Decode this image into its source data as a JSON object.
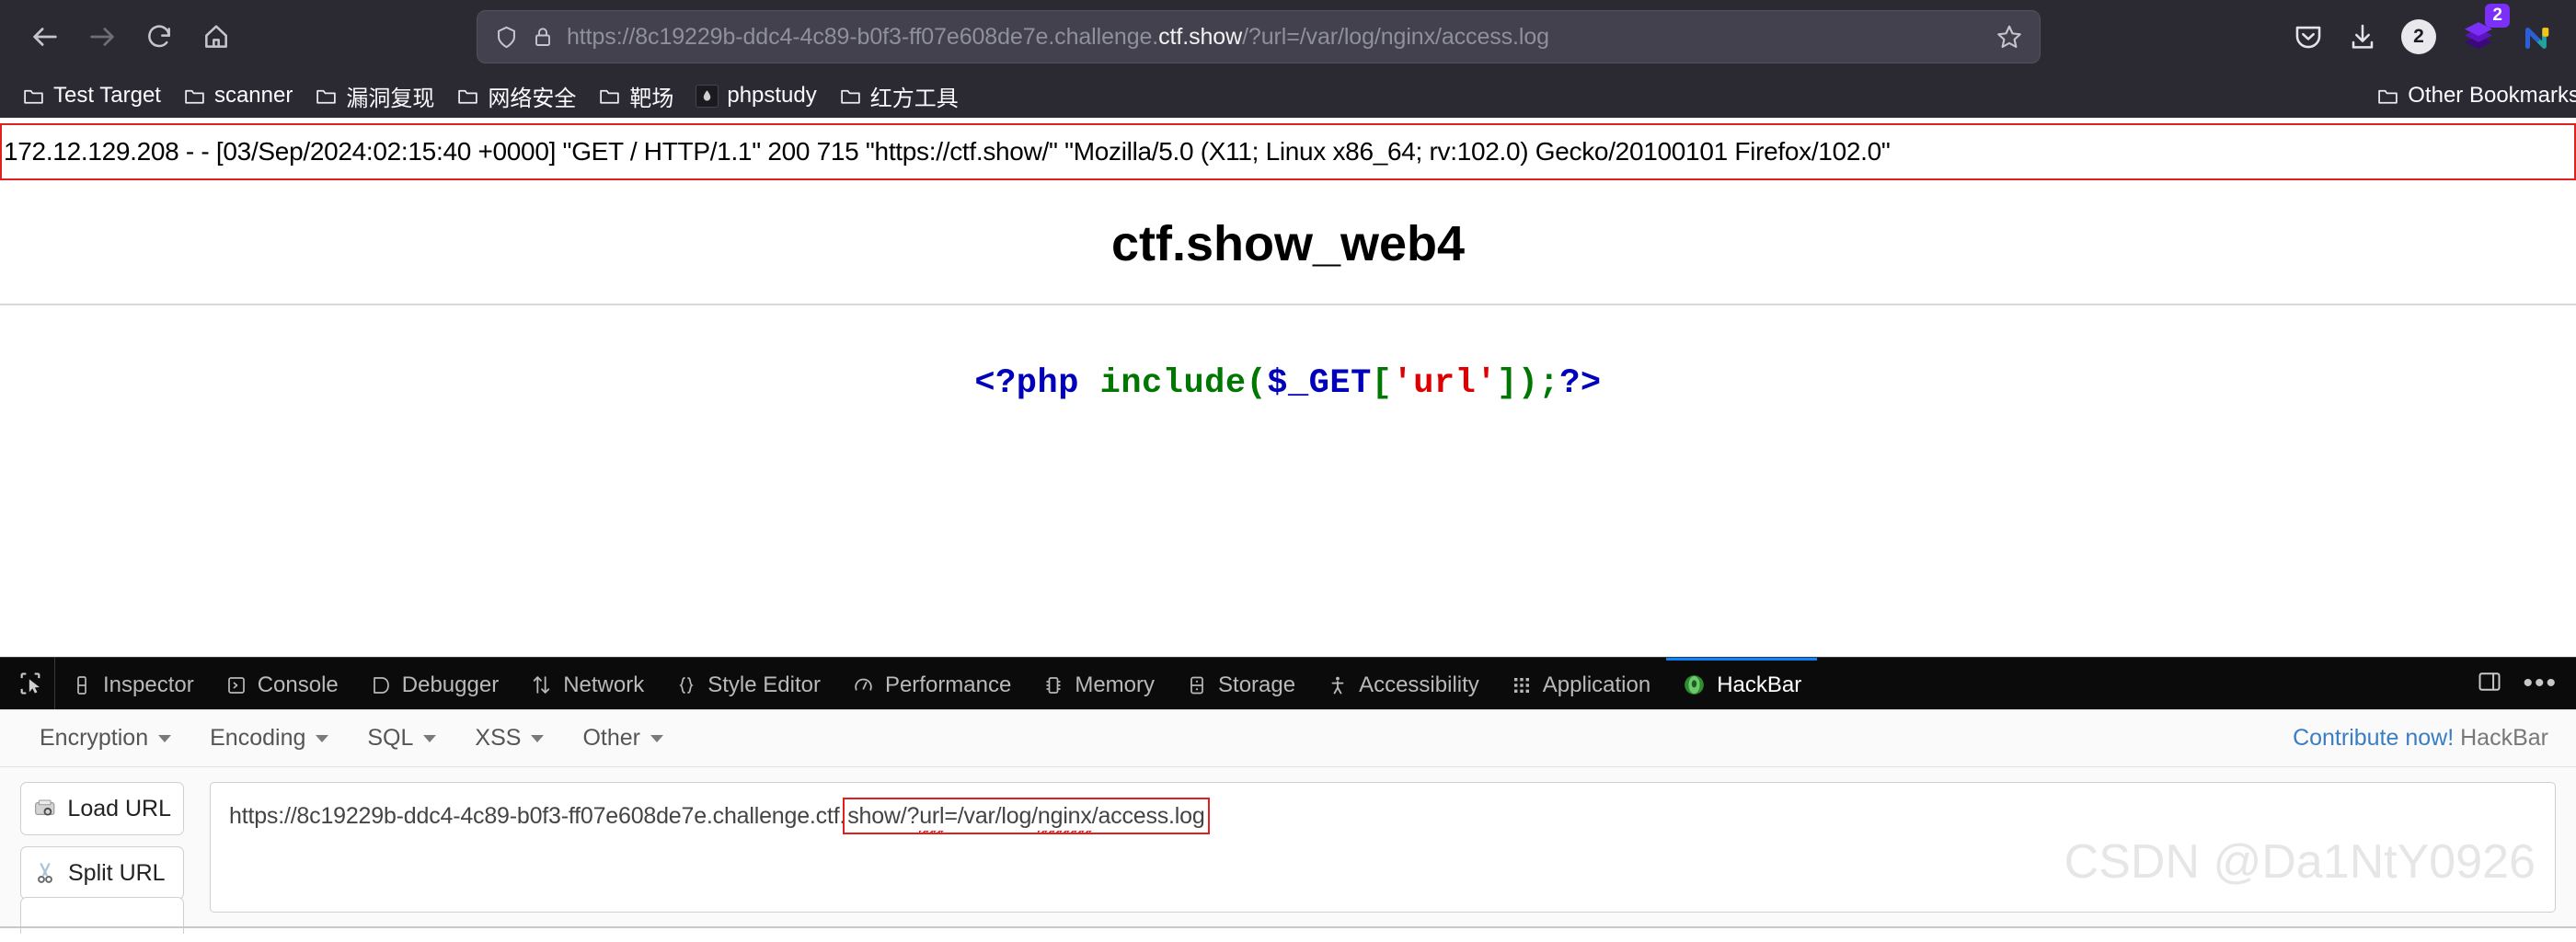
{
  "browser": {
    "nav": {
      "back_label": "Back",
      "forward_label": "Forward",
      "reload_label": "Reload",
      "home_label": "Home"
    },
    "urlbar": {
      "url_prefix": "https://8c19229b-ddc4-4c89-b0f3-ff07e608de7e.challenge.",
      "url_host_strong": "ctf.show",
      "url_suffix": "/?url=/var/log/nginx/access.log",
      "full_url": "https://8c19229b-ddc4-4c89-b0f3-ff07e608de7e.challenge.ctf.show/?url=/var/log/nginx/access.log",
      "shield_icon": "shield-icon",
      "lock_icon": "lock-icon",
      "bookmark_star_icon": "star-icon"
    },
    "toolbar_right": {
      "pocket_icon": "pocket-icon",
      "downloads_icon": "download-icon",
      "account_counter": "2",
      "extension_badge_count": "2",
      "extension_icon": "layers-icon",
      "nightly_icon": "nightly-icon"
    },
    "bookmarks": {
      "items": [
        {
          "label": "Test Target",
          "icon": "folder-icon"
        },
        {
          "label": "scanner",
          "icon": "folder-icon"
        },
        {
          "label": "漏洞复现",
          "icon": "folder-icon"
        },
        {
          "label": "网络安全",
          "icon": "folder-icon"
        },
        {
          "label": "靶场",
          "icon": "folder-icon"
        },
        {
          "label": "phpstudy",
          "icon": "phpstudy-icon"
        },
        {
          "label": "红方工具",
          "icon": "folder-icon"
        }
      ],
      "other_label": "Other Bookmarks",
      "other_icon": "folder-icon"
    }
  },
  "page": {
    "access_log_line": "172.12.129.208 - - [03/Sep/2024:02:15:40 +0000] \"GET / HTTP/1.1\" 200 715 \"https://ctf.show/\" \"Mozilla/5.0 (X11; Linux x86_64; rv:102.0) Gecko/20100101 Firefox/102.0\"",
    "title": "ctf.show_web4",
    "php_code": {
      "open_tag": "<?php",
      "space": " ",
      "func": "include(",
      "var": "$_GET",
      "bracket_open": "[",
      "string": "'url'",
      "bracket_close": "]",
      "close_paren": ");",
      "close_tag": "?>"
    },
    "annotation_color": "#e02020"
  },
  "devtools": {
    "picker_icon": "element-picker-icon",
    "tabs": [
      {
        "label": "Inspector",
        "icon": "inspector-icon",
        "active": false
      },
      {
        "label": "Console",
        "icon": "console-icon",
        "active": false
      },
      {
        "label": "Debugger",
        "icon": "debugger-icon",
        "active": false
      },
      {
        "label": "Network",
        "icon": "network-icon",
        "active": false
      },
      {
        "label": "Style Editor",
        "icon": "style-editor-icon",
        "active": false
      },
      {
        "label": "Performance",
        "icon": "performance-icon",
        "active": false
      },
      {
        "label": "Memory",
        "icon": "memory-icon",
        "active": false
      },
      {
        "label": "Storage",
        "icon": "storage-icon",
        "active": false
      },
      {
        "label": "Accessibility",
        "icon": "accessibility-icon",
        "active": false
      },
      {
        "label": "Application",
        "icon": "application-icon",
        "active": false
      },
      {
        "label": "HackBar",
        "icon": "hackbar-icon",
        "active": true
      }
    ],
    "dock_icon": "dock-panel-icon",
    "more_icon": "more-options-icon",
    "active_tab_accent": "#0a84ff"
  },
  "hackbar": {
    "menu": [
      {
        "label": "Encryption"
      },
      {
        "label": "Encoding"
      },
      {
        "label": "SQL"
      },
      {
        "label": "XSS"
      },
      {
        "label": "Other"
      }
    ],
    "contribute_link": "Contribute now!",
    "contribute_suffix": "HackBar",
    "buttons": [
      {
        "label": "Load URL",
        "icon": "load-url-icon"
      },
      {
        "label": "Split URL",
        "icon": "scissors-icon"
      }
    ],
    "url_field": {
      "value_plain": "https://8c19229b-ddc4-4c89-b0f3-ff07e608de7e.challenge.ctf.",
      "value_boxed_a": "show/?",
      "value_boxed_sq1": "url",
      "value_boxed_b": "=/var/log/",
      "value_boxed_sq2": "nginx",
      "value_boxed_c": "/access.log",
      "full_value": "https://8c19229b-ddc4-4c89-b0f3-ff07e608de7e.challenge.ctf.show/?url=/var/log/nginx/access.log"
    }
  },
  "watermark": "CSDN @Da1NtY0926"
}
